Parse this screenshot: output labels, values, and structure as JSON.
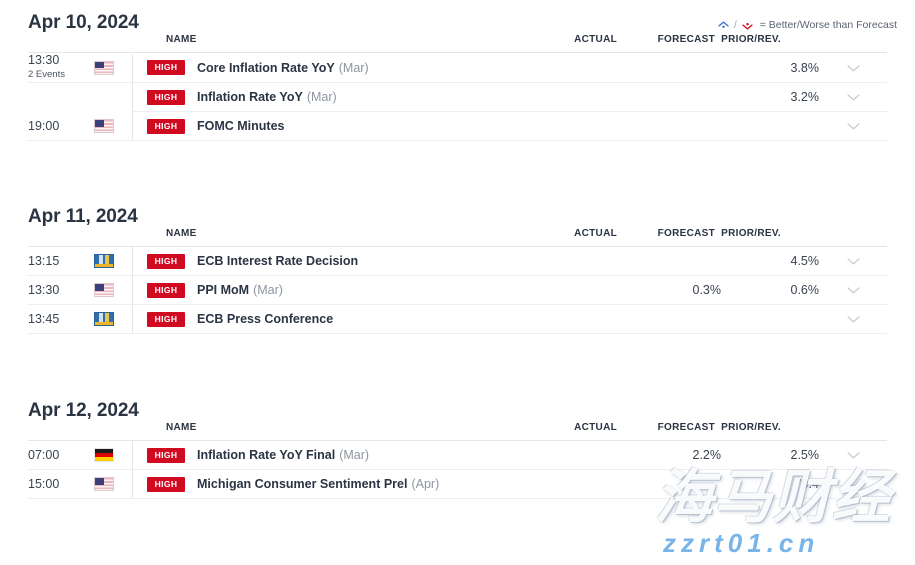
{
  "legend": {
    "better_icon": "chevron-up-dot-icon",
    "worse_icon": "chevron-down-dot-icon",
    "separator": "/",
    "text": "= Better/Worse than Forecast"
  },
  "columns": {
    "time": "",
    "flag": "",
    "name": "NAME",
    "actual": "ACTUAL",
    "forecast": "FORECAST",
    "prior": "PRIOR/REV.",
    "expand": ""
  },
  "days": [
    {
      "date": "Apr 10, 2024",
      "rows": [
        {
          "time": "13:30",
          "events_label": "2 Events",
          "flag": "us",
          "impact": "HIGH",
          "title": "Core Inflation Rate YoY",
          "period": "(Mar)",
          "actual": "",
          "forecast": "",
          "prior": "3.8%",
          "expand_icon": "chevron-down-icon"
        },
        {
          "time": "",
          "events_label": "",
          "flag": "",
          "impact": "HIGH",
          "title": "Inflation Rate YoY",
          "period": "(Mar)",
          "actual": "",
          "forecast": "",
          "prior": "3.2%",
          "expand_icon": "chevron-down-icon"
        },
        {
          "time": "19:00",
          "events_label": "",
          "flag": "us",
          "impact": "HIGH",
          "title": "FOMC Minutes",
          "period": "",
          "actual": "",
          "forecast": "",
          "prior": "",
          "expand_icon": "chevron-down-icon"
        }
      ]
    },
    {
      "date": "Apr 11, 2024",
      "rows": [
        {
          "time": "13:15",
          "events_label": "",
          "flag": "eu",
          "impact": "HIGH",
          "title": "ECB Interest Rate Decision",
          "period": "",
          "actual": "",
          "forecast": "",
          "prior": "4.5%",
          "expand_icon": "chevron-down-icon"
        },
        {
          "time": "13:30",
          "events_label": "",
          "flag": "us",
          "impact": "HIGH",
          "title": "PPI MoM",
          "period": "(Mar)",
          "actual": "",
          "forecast": "0.3%",
          "prior": "0.6%",
          "expand_icon": "chevron-down-icon"
        },
        {
          "time": "13:45",
          "events_label": "",
          "flag": "eu",
          "impact": "HIGH",
          "title": "ECB Press Conference",
          "period": "",
          "actual": "",
          "forecast": "",
          "prior": "",
          "expand_icon": "chevron-down-icon"
        }
      ]
    },
    {
      "date": "Apr 12, 2024",
      "rows": [
        {
          "time": "07:00",
          "events_label": "",
          "flag": "de",
          "impact": "HIGH",
          "title": "Inflation Rate YoY Final",
          "period": "(Mar)",
          "actual": "",
          "forecast": "2.2%",
          "prior": "2.5%",
          "expand_icon": "chevron-down-icon"
        },
        {
          "time": "15:00",
          "events_label": "",
          "flag": "us",
          "impact": "HIGH",
          "title": "Michigan Consumer Sentiment Prel",
          "period": "(Apr)",
          "actual": "",
          "forecast": "",
          "prior": "79.4",
          "expand_icon": "chevron-down-icon"
        }
      ]
    }
  ],
  "watermark": {
    "brand": "海马财经",
    "url": "zzrt01.cn"
  },
  "colors": {
    "impact_high": "#d00a20",
    "heading": "#2b3443",
    "better": "#2f6fd0",
    "worse": "#d00a20",
    "watermark_url": "#79b4e8"
  }
}
